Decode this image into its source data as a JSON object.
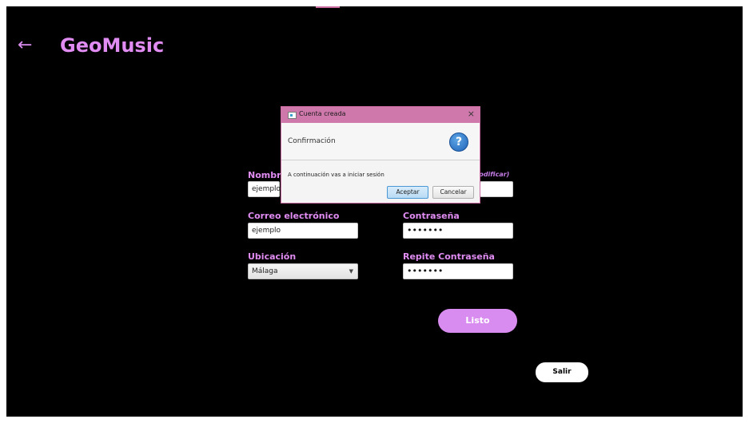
{
  "app": {
    "title": "GeoMusic",
    "back_glyph": "←"
  },
  "form": {
    "name_label": "Nombre",
    "name_value": "ejemplo",
    "username_hint": "modificar)",
    "username_value": "",
    "email_label": "Correo electrónico",
    "email_value": "ejemplo",
    "password_label": "Contraseña",
    "password_value": "•••••••",
    "location_label": "Ubicación",
    "location_value": "Málaga",
    "repeat_password_label": "Repite Contraseña",
    "repeat_password_value": "•••••••",
    "done_button": "Listo",
    "exit_button": "Salir"
  },
  "dialog": {
    "title": "Cuenta creada",
    "close_glyph": "×",
    "header": "Confirmación",
    "icon_glyph": "?",
    "message": "A continuación vas a iniciar sesión",
    "ok_button": "Aceptar",
    "cancel_button": "Cancelar"
  },
  "colors": {
    "background": "#000000",
    "accent": "#e08cf2",
    "dialog_titlebar": "#cf78ab",
    "primary_button": "#d98cf0"
  },
  "icons": {
    "back": "back-arrow-icon",
    "dialog_window": "window-icon",
    "question": "question-icon",
    "close": "close-icon",
    "dropdown": "chevron-down-icon"
  }
}
